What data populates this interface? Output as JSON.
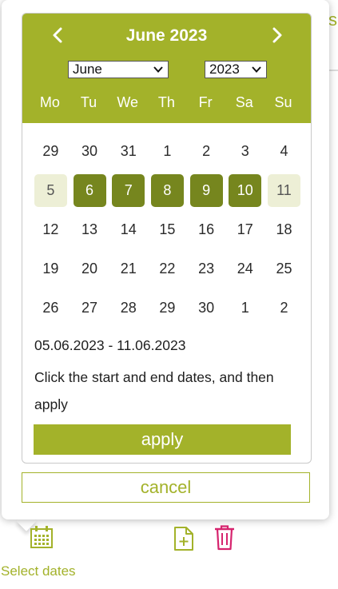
{
  "background": {
    "tab_fragment": "s"
  },
  "datepicker": {
    "title": "June 2023",
    "nav": {
      "prev_icon": "chevron-left-icon",
      "next_icon": "chevron-right-icon"
    },
    "month_select": {
      "value": "June",
      "icon": "chevron-down-icon"
    },
    "year_select": {
      "value": "2023",
      "icon": "chevron-down-icon"
    },
    "weekdays": [
      "Mo",
      "Tu",
      "We",
      "Th",
      "Fr",
      "Sa",
      "Su"
    ],
    "weeks": [
      [
        "29",
        "30",
        "31",
        "1",
        "2",
        "3",
        "4"
      ],
      [
        "5",
        "6",
        "7",
        "8",
        "9",
        "10",
        "11"
      ],
      [
        "12",
        "13",
        "14",
        "15",
        "16",
        "17",
        "18"
      ],
      [
        "19",
        "20",
        "21",
        "22",
        "23",
        "24",
        "25"
      ],
      [
        "26",
        "27",
        "28",
        "29",
        "30",
        "1",
        "2"
      ]
    ],
    "selection": {
      "start": "5",
      "end": "11",
      "range_text": "05.06.2023 - 11.06.2023"
    },
    "hint": "Click the start and end dates, and then apply",
    "apply_label": "apply",
    "cancel_label": "cancel"
  },
  "toolbar": {
    "select_dates_label": "Select dates",
    "icons": [
      "calendar-icon",
      "file-add-icon",
      "trash-icon"
    ]
  },
  "colors": {
    "accent": "#a3b22a",
    "selected_range": "#76861e",
    "range_endpoint": "#edefd6",
    "danger": "#d6246e"
  }
}
